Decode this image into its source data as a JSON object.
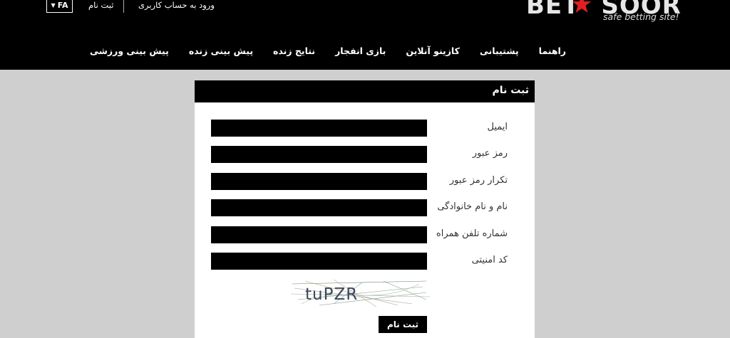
{
  "header": {
    "logo_text": "BET",
    "logo_text_2": "SOOR",
    "logo_tagline": "safe betting site!",
    "lang": "FA",
    "register_link": "ثبت نام",
    "login_link": "ورود به حساب کاربری"
  },
  "nav": {
    "items": [
      "پیش بینی ورزشی",
      "پیش بینی زنده",
      "نتایج زنده",
      "بازی انفجار",
      "کازینو آنلاین",
      "پشتیبانی",
      "راهنما"
    ]
  },
  "form": {
    "title": "ثبت نام",
    "fields": [
      {
        "label": "ایمیل",
        "value": ""
      },
      {
        "label": "رمز عبور",
        "value": ""
      },
      {
        "label": "تکرار رمز عبور",
        "value": ""
      },
      {
        "label": "نام و نام خانوادگی",
        "value": ""
      },
      {
        "label": "شماره تلفن همراه",
        "value": ""
      },
      {
        "label": "کد امنیتی",
        "value": ""
      }
    ],
    "captcha_text": "tuPZR",
    "submit_label": "ثبت نام"
  },
  "colors": {
    "header_bg": "#000000",
    "page_bg": "#cfcfcf",
    "accent_star": "#e02020"
  }
}
